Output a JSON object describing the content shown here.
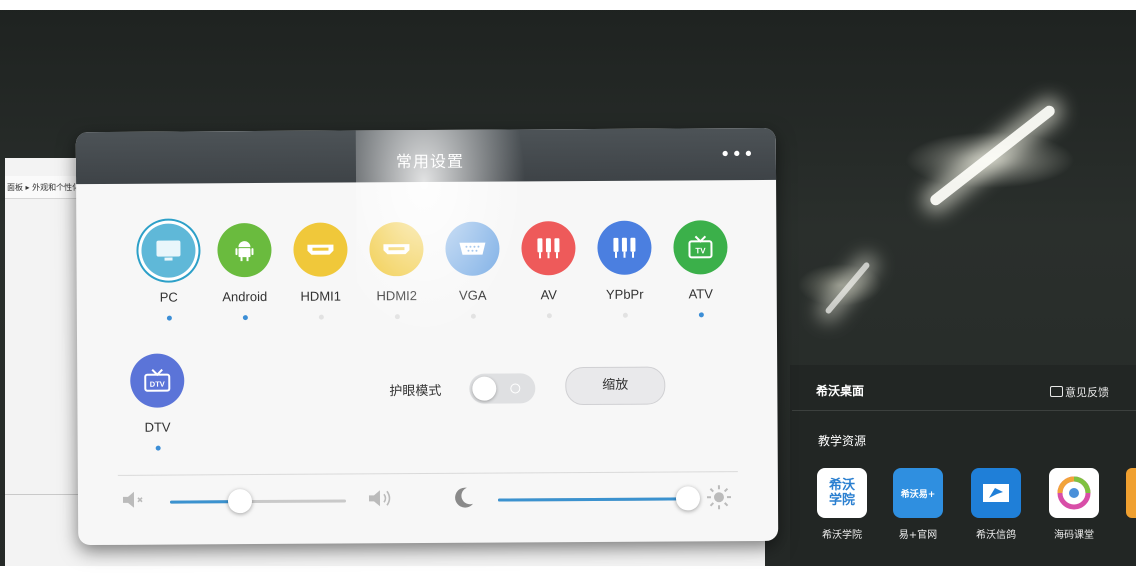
{
  "background": {
    "breadcrumb": "面板 ▸ 外观和个性化 ▸ 显"
  },
  "desktop": {
    "title": "希沃桌面",
    "feedback": "意见反馈",
    "section": "教学资源",
    "apps": [
      {
        "label": "希沃学院",
        "icon": "seewo-academy-icon",
        "color": "#ffffff",
        "icon_text": "希沃学院"
      },
      {
        "label": "易+官网",
        "icon": "easy-plus-icon",
        "color": "#2f8fe0",
        "icon_text": "希沃易+"
      },
      {
        "label": "希沃信鸽",
        "icon": "pigeon-icon",
        "color": "#1f7fd8",
        "icon_text": ""
      },
      {
        "label": "海码课堂",
        "icon": "haima-icon",
        "color": "#ffffff",
        "icon_text": ""
      }
    ]
  },
  "dialog": {
    "title": "常用设置",
    "more": "•••",
    "sources": [
      {
        "label": "PC",
        "icon": "monitor-icon",
        "color": "#5fb8d8",
        "selected": true,
        "signal": true
      },
      {
        "label": "Android",
        "icon": "android-icon",
        "color": "#6abb3e",
        "selected": false,
        "signal": true
      },
      {
        "label": "HDMI1",
        "icon": "hdmi-icon",
        "color": "#f0c83a",
        "selected": false,
        "signal": false
      },
      {
        "label": "HDMI2",
        "icon": "hdmi-icon",
        "color": "#f0c83a",
        "selected": false,
        "signal": false
      },
      {
        "label": "VGA",
        "icon": "vga-icon",
        "color": "#7fb0e6",
        "selected": false,
        "signal": false
      },
      {
        "label": "AV",
        "icon": "av-icon",
        "color": "#ee5a5a",
        "selected": false,
        "signal": false
      },
      {
        "label": "YPbPr",
        "icon": "ypbpr-icon",
        "color": "#4b7fe0",
        "selected": false,
        "signal": false
      },
      {
        "label": "ATV",
        "icon": "tv-icon",
        "color": "#3bb04a",
        "selected": false,
        "signal": true
      },
      {
        "label": "DTV",
        "icon": "dtv-icon",
        "color": "#5b74d8",
        "selected": false,
        "signal": true
      }
    ],
    "eye_mode_label": "护眼模式",
    "eye_mode_on": false,
    "zoom_label": "缩放",
    "volume_level": 0.4,
    "brightness_level": 1.0
  },
  "colors": {
    "accent": "#3b92cf",
    "header": "#464b4f"
  }
}
